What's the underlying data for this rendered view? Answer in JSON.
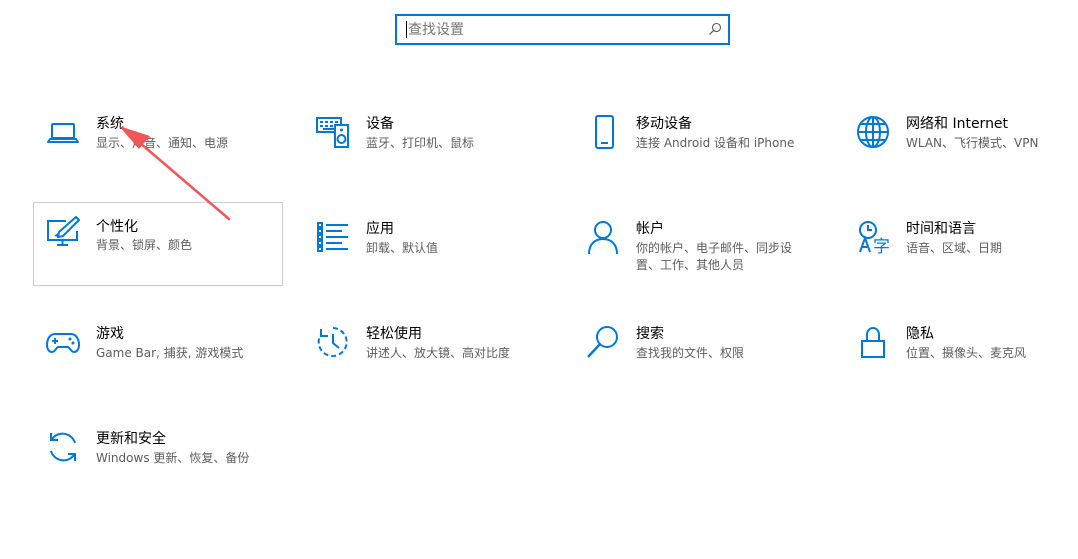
{
  "search": {
    "placeholder": "查找设置"
  },
  "tiles": [
    {
      "title": "系统",
      "desc": "显示、声音、通知、电源",
      "icon": "laptop-icon"
    },
    {
      "title": "设备",
      "desc": "蓝牙、打印机、鼠标",
      "icon": "keyboard-speaker-icon"
    },
    {
      "title": "移动设备",
      "desc": "连接 Android 设备和 iPhone",
      "icon": "phone-icon"
    },
    {
      "title": "网络和 Internet",
      "desc": "WLAN、飞行模式、VPN",
      "icon": "globe-icon"
    },
    {
      "title": "个性化",
      "desc": "背景、锁屏、颜色",
      "icon": "monitor-pen-icon"
    },
    {
      "title": "应用",
      "desc": "卸载、默认值",
      "icon": "apps-list-icon"
    },
    {
      "title": "帐户",
      "desc": "你的帐户、电子邮件、同步设置、工作、其他人员",
      "icon": "person-icon"
    },
    {
      "title": "时间和语言",
      "desc": "语音、区域、日期",
      "icon": "time-language-icon"
    },
    {
      "title": "游戏",
      "desc": "Game Bar, 捕获, 游戏模式",
      "icon": "gamepad-icon"
    },
    {
      "title": "轻松使用",
      "desc": "讲述人、放大镜、高对比度",
      "icon": "ease-of-access-icon"
    },
    {
      "title": "搜索",
      "desc": "查找我的文件、权限",
      "icon": "magnifier-icon"
    },
    {
      "title": "隐私",
      "desc": "位置、摄像头、麦克风",
      "icon": "lock-icon"
    },
    {
      "title": "更新和安全",
      "desc": "Windows 更新、恢复、备份",
      "icon": "sync-arrows-icon"
    }
  ],
  "colors": {
    "accent": "#0078d7",
    "annotation_arrow": "#f0565a"
  }
}
